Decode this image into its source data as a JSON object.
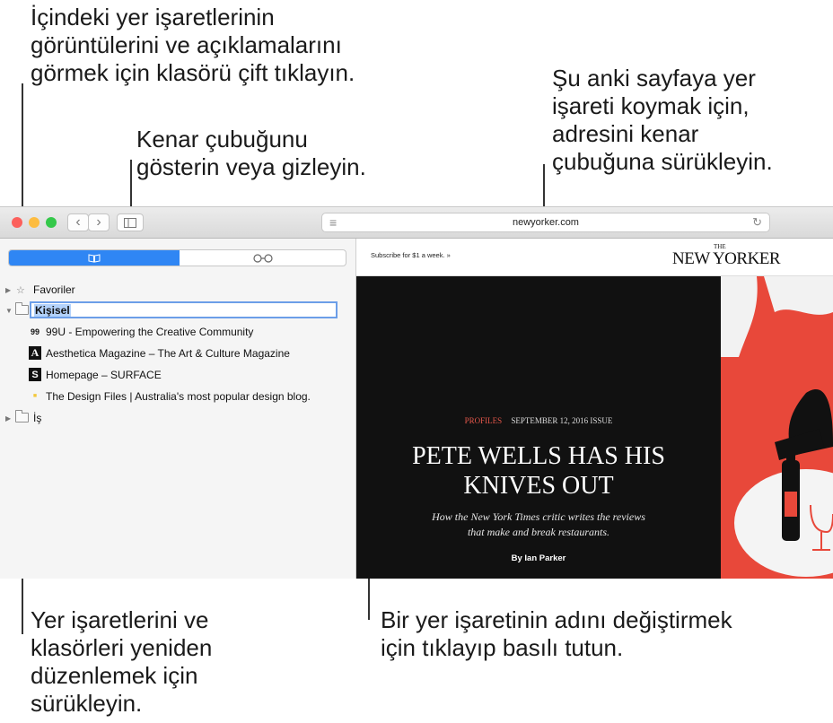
{
  "callouts": {
    "top_left": [
      "İçindeki yer işaretlerinin",
      "görüntülerini ve açıklamalarını",
      "görmek için klasörü çift tıklayın."
    ],
    "sidebar_toggle": [
      "Kenar çubuğunu",
      "gösterin veya gizleyin."
    ],
    "address": [
      "Şu anki sayfaya yer",
      "işareti koymak için,",
      "adresini kenar",
      "çubuğuna sürükleyin."
    ],
    "bottom_left": [
      "Yer işaretlerini ve",
      "klasörleri yeniden",
      "düzenlemek için",
      "sürükleyin."
    ],
    "bottom_right": [
      "Bir yer işaretinin adını değiştirmek",
      "için tıklayıp basılı tutun."
    ]
  },
  "browser": {
    "url": "newyorker.com",
    "back_glyph": "‹",
    "forward_glyph": "›",
    "reader_glyph": "≡",
    "reload_glyph": "↻",
    "colors": {
      "close": "#fc605c",
      "minimize": "#fdbc40",
      "zoom": "#34c84a",
      "selection": "#2f86f4"
    }
  },
  "sidebar": {
    "tab_bookmarks_glyph": "📖",
    "tab_reading_glyph": "○○",
    "favorites": {
      "label": "Favoriler",
      "icon_glyph": "☆"
    },
    "personal": {
      "label": "Kişisel",
      "bookmarks": [
        {
          "icon": "99",
          "label": "99U - Empowering the Creative Community"
        },
        {
          "icon": "A",
          "label": "Aesthetica Magazine – The Art & Culture Magazine"
        },
        {
          "icon": "S",
          "label": "Homepage – SURFACE"
        },
        {
          "icon": "■",
          "label": "The Design Files | Australia's most popular design blog."
        }
      ]
    },
    "work": {
      "label": "İş"
    }
  },
  "page": {
    "subscribe": "Subscribe for $1 a week. »",
    "logo_small": "THE",
    "logo": "NEW YORKER",
    "section": "PROFILES",
    "issue": "SEPTEMBER 12, 2016 ISSUE",
    "headline_1": "PETE WELLS HAS HIS",
    "headline_2": "KNIVES OUT",
    "dek_1": "How the New York Times critic writes the reviews",
    "dek_2": "that make and break restaurants.",
    "byline": "By Ian Parker"
  }
}
